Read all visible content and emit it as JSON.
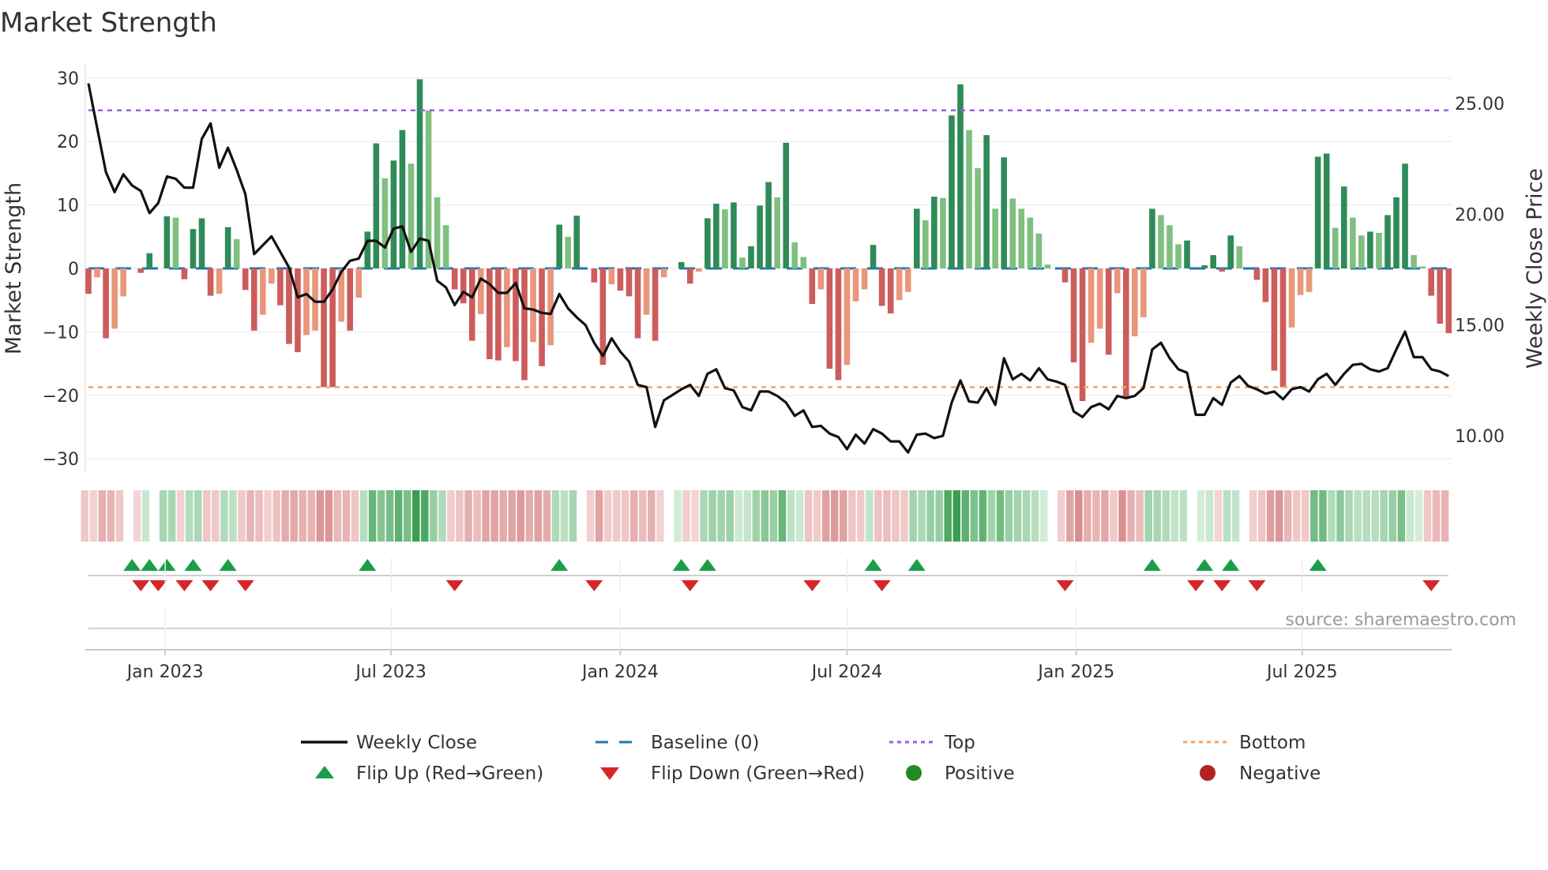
{
  "chart_data": {
    "type": "bar+line",
    "title": "Market Strength",
    "ylabel": "Market Strength",
    "y2label": "Weekly Close Price",
    "ylim": [
      -32,
      32
    ],
    "y2lim": [
      8.55,
      26.2
    ],
    "yticks": [
      "30",
      "20",
      "10",
      "0",
      "−10",
      "−20",
      "−30"
    ],
    "ytick_values": [
      30,
      20,
      10,
      0,
      -10,
      -20,
      -30
    ],
    "y2ticks": [
      "25.00",
      "20.00",
      "15.00",
      "10.00"
    ],
    "y2tick_values": [
      25,
      20,
      15,
      10
    ],
    "xticks": [
      {
        "label": "Jan 2023",
        "week": 8.8
      },
      {
        "label": "Jul 2023",
        "week": 34.7
      },
      {
        "label": "Jan 2024",
        "week": 61.0
      },
      {
        "label": "Jul 2024",
        "week": 87.0
      },
      {
        "label": "Jan 2025",
        "week": 113.3
      },
      {
        "label": "Jul 2025",
        "week": 139.2
      }
    ],
    "top_level": 24.9,
    "bottom_level": -18.7,
    "baseline": 0,
    "strength": [
      -4.0,
      -1.4,
      -11.0,
      -9.5,
      -4.4,
      0,
      -0.7,
      2.4,
      0,
      8.2,
      8.0,
      -1.7,
      6.2,
      7.9,
      -4.3,
      -4.0,
      6.5,
      4.6,
      -3.4,
      -9.8,
      -7.3,
      -2.4,
      -5.8,
      -11.9,
      -13.2,
      -10.5,
      -9.8,
      -18.7,
      -18.7,
      -8.4,
      -9.8,
      -4.6,
      5.8,
      19.7,
      14.2,
      17.0,
      21.8,
      16.5,
      29.8,
      24.9,
      11.2,
      6.8,
      -3.3,
      -5.5,
      -11.4,
      -7.2,
      -14.3,
      -14.5,
      -12.4,
      -14.6,
      -17.6,
      -11.6,
      -15.4,
      -12.1,
      6.9,
      5.0,
      8.3,
      0,
      -2.2,
      -15.2,
      -2.5,
      -3.5,
      -4.4,
      -11.0,
      -7.3,
      -11.4,
      -1.4,
      0,
      1.0,
      -2.4,
      -0.5,
      7.9,
      10.2,
      9.3,
      10.4,
      1.7,
      3.5,
      9.9,
      13.6,
      11.2,
      19.8,
      4.1,
      1.8,
      -5.6,
      -3.3,
      -15.8,
      -17.6,
      -15.2,
      -5.2,
      -3.3,
      3.7,
      -5.9,
      -7.1,
      -5.0,
      -3.7,
      9.4,
      7.6,
      11.3,
      11.1,
      24.1,
      29.0,
      21.8,
      15.8,
      21.0,
      9.4,
      17.5,
      11.0,
      9.4,
      8.0,
      5.5,
      0.6,
      0,
      -2.2,
      -14.8,
      -20.9,
      -11.7,
      -9.5,
      -13.6,
      -3.9,
      -20.3,
      -10.7,
      -7.7,
      9.4,
      8.4,
      6.8,
      3.8,
      4.4,
      0,
      0.5,
      2.1,
      -0.5,
      5.2,
      3.5,
      0,
      -1.8,
      -5.3,
      -16.1,
      -18.7,
      -9.3,
      -4.2,
      -3.7,
      17.6,
      18.1,
      6.4,
      12.9,
      8.0,
      5.2,
      5.8,
      5.6,
      8.4,
      11.2,
      16.5,
      2.1,
      0.3,
      -4.3,
      -8.7,
      -10.2
    ],
    "weekly_close": [
      25.9,
      23.9,
      21.9,
      21.0,
      21.8,
      21.3,
      21.05,
      20.05,
      20.5,
      21.7,
      21.6,
      21.2,
      21.2,
      23.4,
      24.1,
      22.1,
      23.0,
      22.0,
      20.9,
      18.2,
      18.6,
      19.0,
      18.3,
      17.6,
      16.25,
      16.4,
      16.05,
      16.05,
      16.6,
      17.4,
      17.9,
      18.0,
      18.8,
      18.8,
      18.5,
      19.35,
      19.45,
      18.3,
      18.9,
      18.8,
      17.0,
      16.7,
      15.9,
      16.5,
      16.25,
      17.1,
      16.85,
      16.45,
      16.45,
      16.9,
      15.75,
      15.7,
      15.55,
      15.5,
      16.4,
      15.75,
      15.35,
      15.0,
      14.2,
      13.6,
      14.4,
      13.8,
      13.35,
      12.3,
      12.2,
      10.4,
      11.6,
      11.85,
      12.1,
      12.3,
      11.8,
      12.8,
      13.0,
      12.15,
      12.05,
      11.3,
      11.15,
      12.0,
      12.0,
      11.8,
      11.5,
      10.9,
      11.15,
      10.4,
      10.45,
      10.1,
      9.95,
      9.4,
      10.05,
      9.65,
      10.3,
      10.1,
      9.75,
      9.75,
      9.25,
      10.05,
      10.1,
      9.9,
      10.0,
      11.5,
      12.5,
      11.55,
      11.5,
      12.15,
      11.4,
      13.5,
      12.55,
      12.8,
      12.5,
      13.05,
      12.55,
      12.45,
      12.3,
      11.1,
      10.85,
      11.3,
      11.45,
      11.2,
      11.8,
      11.7,
      11.8,
      12.15,
      13.9,
      14.2,
      13.5,
      13.0,
      12.85,
      10.95,
      10.95,
      11.7,
      11.4,
      12.4,
      12.7,
      12.25,
      12.1,
      11.9,
      12.0,
      11.65,
      12.1,
      12.2,
      12.0,
      12.55,
      12.8,
      12.3,
      12.8,
      13.2,
      13.25,
      13.0,
      12.9,
      13.05,
      13.9,
      14.7,
      13.55,
      13.55,
      13.0,
      12.9,
      12.7
    ],
    "flip_up_weeks": [
      5,
      7,
      9,
      12,
      16,
      32,
      54,
      68,
      71,
      90,
      95,
      122,
      128,
      131,
      141
    ],
    "flip_down_weeks": [
      6,
      8,
      11,
      14,
      18,
      42,
      58,
      69,
      83,
      91,
      112,
      127,
      130,
      134,
      154
    ],
    "legend": {
      "weekly_close": "Weekly Close",
      "baseline": "Baseline (0)",
      "top": "Top",
      "bottom": "Bottom",
      "flip_up": "Flip Up (Red→Green)",
      "flip_down": "Flip Down (Green→Red)",
      "positive": "Positive",
      "negative": "Negative"
    },
    "legend_placement": "bottom",
    "source": "source: sharemaestro.com",
    "colors": {
      "pos_rising": "#2e8b57",
      "pos_falling": "#7fbf7f",
      "neg_falling": "#cd5c5c",
      "neg_rising": "#e9967a",
      "close_line": "#111111",
      "baseline": "#1f77b4",
      "top": "#9b5de5",
      "bottom": "#f4a460",
      "flip_up": "#1a9e4a",
      "flip_down": "#d62728",
      "positive": "#228b22",
      "negative": "#b22222"
    }
  }
}
